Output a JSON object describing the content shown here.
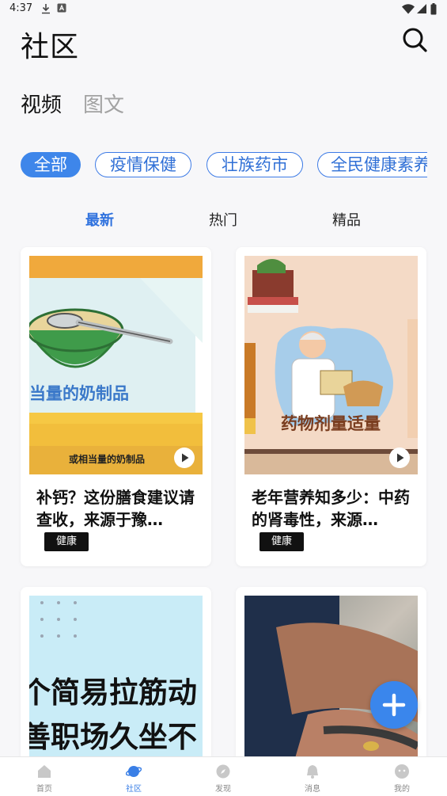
{
  "status_bar": {
    "time": "4:37"
  },
  "header": {
    "title": "社区"
  },
  "content_types": [
    "视频",
    "图文"
  ],
  "categories": [
    "全部",
    "疫情保健",
    "壮族药市",
    "全民健康素养"
  ],
  "sort_tabs": [
    "最新",
    "热门",
    "精品"
  ],
  "cards": [
    {
      "title": "补钙？这份膳食建议请查收，来源于豫…",
      "tag": "健康",
      "thumb_caption": "或相当量的奶制品",
      "thumb_overlay": "当量的奶制品"
    },
    {
      "title": "老年营养知多少：中药的肾毒性，来源…",
      "tag": "健康",
      "thumb_overlay": "药物剂量适量"
    },
    {
      "thumb_overlay_line1": "个简易拉筋动",
      "thumb_overlay_line2": "善职场久坐不"
    },
    {}
  ],
  "bottom_nav": [
    {
      "label": "首页",
      "icon": "home-icon"
    },
    {
      "label": "社区",
      "icon": "planet-icon"
    },
    {
      "label": "发现",
      "icon": "compass-icon"
    },
    {
      "label": "消息",
      "icon": "bell-icon"
    },
    {
      "label": "我的",
      "icon": "user-icon"
    }
  ],
  "colors": {
    "accent": "#3e86ea",
    "background": "#f7f7f9"
  }
}
